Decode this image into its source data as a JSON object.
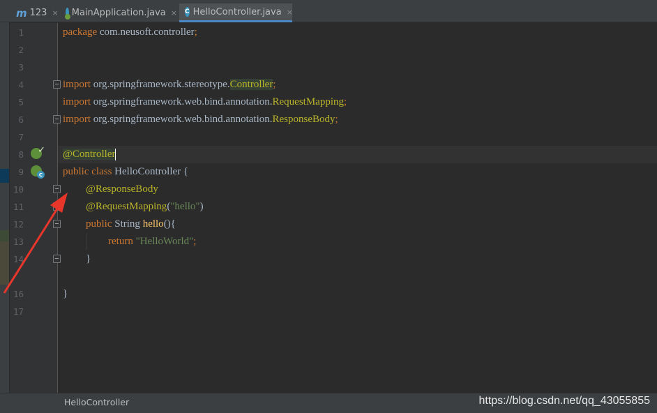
{
  "tabs": [
    {
      "label": "123",
      "icon": "m-module-icon",
      "active": false
    },
    {
      "label": "MainApplication.java",
      "icon": "spring-app-icon",
      "active": false
    },
    {
      "label": "HelloController.java",
      "icon": "class-icon",
      "active": true
    }
  ],
  "close_glyph": "×",
  "class_icon_glyph": "C",
  "module_glyph": "m",
  "line_numbers": [
    "1",
    "2",
    "3",
    "4",
    "5",
    "6",
    "7",
    "8",
    "9",
    "10",
    "11",
    "12",
    "13",
    "14",
    "16",
    "17"
  ],
  "code": {
    "l1": {
      "kw": "package",
      "rest": " com.neusoft.controller",
      "semi": ";"
    },
    "l4": {
      "kw": "import",
      "pkg": " org.springframework.stereotype.",
      "cls": "Controller",
      "semi": ";"
    },
    "l5": {
      "kw": "import",
      "pkg": " org.springframework.web.bind.annotation.",
      "cls": "RequestMapping",
      "semi": ";"
    },
    "l6": {
      "kw": "import",
      "pkg": " org.springframework.web.bind.annotation.",
      "cls": "ResponseBody",
      "semi": ";"
    },
    "l8": {
      "ann": "@Controller"
    },
    "l9": {
      "kw": "public class",
      "rest": " HelloController {"
    },
    "l10": {
      "ann": "@ResponseBody"
    },
    "l11": {
      "ann": "@RequestMapping",
      "open": "(",
      "str": "\"hello\"",
      "close": ")"
    },
    "l12": {
      "kw": "public",
      "type": " String ",
      "fn": "hello",
      "rest": "(){"
    },
    "l13": {
      "kw": "return",
      "str": " \"HelloWorld\"",
      "semi": ";"
    },
    "l14": {
      "rest": "}"
    },
    "l16": {
      "rest": "}"
    }
  },
  "colors": {
    "keyword": "#cc7832",
    "annotation": "#bbb529",
    "string": "#6a8759",
    "method": "#ffc66d",
    "arrow": "#e8362b"
  },
  "status": {
    "breadcrumb": "HelloController"
  },
  "watermark": "https://blog.csdn.net/qq_43055855"
}
